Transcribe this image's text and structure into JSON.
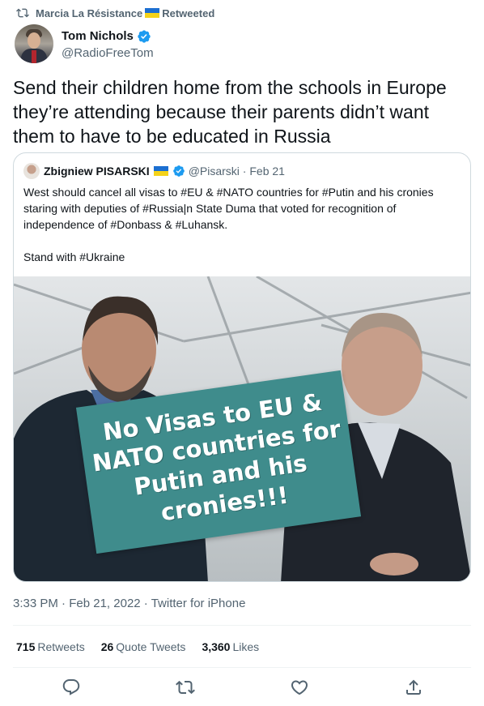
{
  "retweet_banner": {
    "user": "Marcia La Résistance",
    "label": "Retweeted"
  },
  "author": {
    "name": "Tom Nichols",
    "handle": "@RadioFreeTom"
  },
  "tweet": {
    "text": "Send their children home from the schools in Europe they’re attending because their parents didn’t want them to have to be educated in Russia"
  },
  "quoted_tweet": {
    "name": "Zbigniew PISARSKI",
    "handle": "@Pisarski",
    "date": "Feb 21",
    "text_line1": "West should cancel all visas to #EU & #NATO countries for #Putin and his cronies staring with deputies of #Russia|n State Duma that voted for recognition of independence of #Donbass & #Luhansk.",
    "text_line2": "Stand with #Ukraine",
    "image_banner": "No Visas to EU & NATO countries for Putin and his cronies!!!"
  },
  "meta": {
    "time": "3:33 PM",
    "date": "Feb 21, 2022",
    "source": "Twitter for iPhone",
    "sep": "·"
  },
  "stats": {
    "retweets_count": "715",
    "retweets_label": "Retweets",
    "quotes_count": "26",
    "quotes_label": "Quote Tweets",
    "likes_count": "3,360",
    "likes_label": "Likes"
  },
  "colors": {
    "verified": "#1d9bf0",
    "banner": "#3f8c8c",
    "muted": "#536471"
  },
  "icons": [
    "retweet-icon",
    "verified-icon",
    "reply-icon",
    "like-icon",
    "share-icon"
  ]
}
